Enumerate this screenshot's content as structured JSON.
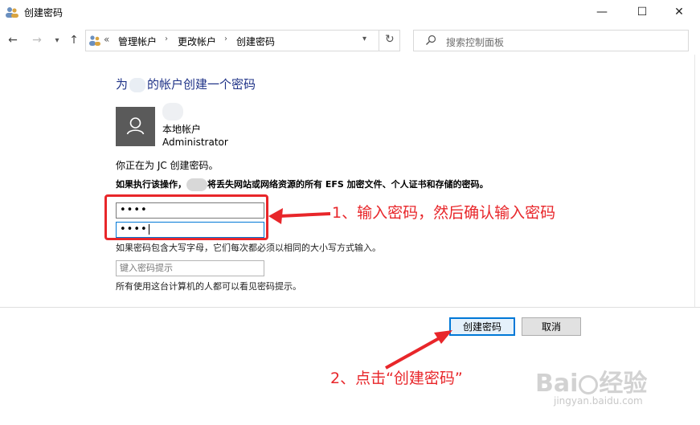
{
  "window": {
    "title": "创建密码",
    "minimize": "—",
    "maximize": "☐",
    "close": "✕"
  },
  "nav": {
    "back": "←",
    "forward": "→",
    "recent": "▾",
    "up": "↑"
  },
  "address": {
    "overflow": "«",
    "crumbs": [
      "管理帐户",
      "更改帐户",
      "创建密码"
    ],
    "separator": "›",
    "dropdown": "▾",
    "refresh": "↻"
  },
  "search": {
    "placeholder": "搜索控制面板"
  },
  "page": {
    "title_before": "为",
    "title_after": "的帐户创建一个密码",
    "account_type": "本地帐户",
    "account_role": "Administrator",
    "info": "你正在为 JC 创建密码。",
    "warning_before": "如果执行该操作，",
    "warning_after": "将丢失网站或网络资源的所有 EFS 加密文件、个人证书和存储的密码。",
    "password_value": "••••",
    "confirm_value": "••••",
    "case_note": "如果密码包含大写字母，它们每次都必须以相同的大小写方式输入。",
    "hint_placeholder": "键入密码提示",
    "hint_note": "所有使用这台计算机的人都可以看见密码提示。"
  },
  "buttons": {
    "create": "创建密码",
    "cancel": "取消"
  },
  "annotations": {
    "step1": "1、输入密码，然后确认输入密码",
    "step2": "2、点击“创建密码”",
    "color": "#e8262a"
  },
  "watermark": {
    "brand_left": "Bai",
    "brand_right": "经验",
    "url": "jingyan.baidu.com"
  },
  "icons": {
    "app": "users-icon",
    "avatar": "user-icon",
    "search": "search-icon"
  }
}
